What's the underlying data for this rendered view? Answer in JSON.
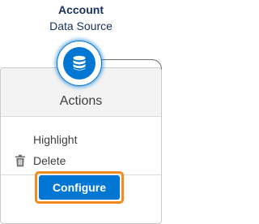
{
  "node": {
    "title": "Account",
    "subtitle": "Data Source",
    "icon": "database-icon",
    "accent_color": "#0176d3"
  },
  "menu": {
    "header": "Actions",
    "items": [
      {
        "label": "Highlight",
        "icon": ""
      },
      {
        "label": "Delete",
        "icon": "trash-icon"
      }
    ],
    "primary_button": "Configure"
  },
  "colors": {
    "primary": "#0176d3",
    "focus_ring": "#f28b1b",
    "header_bg": "#f3f3f3"
  }
}
